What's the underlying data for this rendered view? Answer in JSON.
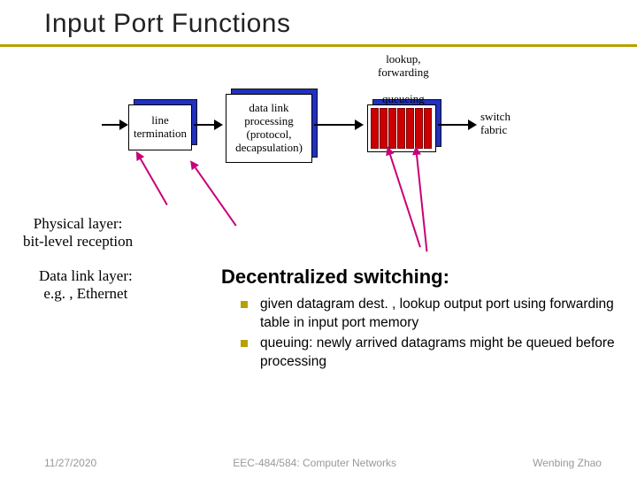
{
  "title": "Input Port Functions",
  "diagram": {
    "box1": "line\ntermination",
    "box2": "data link\nprocessing\n(protocol,\ndecapsulation)",
    "box3_label": "lookup,\nforwarding\n\nqueueing",
    "switch_label": "switch\nfabric"
  },
  "annotations": {
    "physical": "Physical layer:\nbit-level reception",
    "datalink": "Data link layer:\ne.g. , Ethernet"
  },
  "decentralized": {
    "heading": "Decentralized switching:",
    "bullets": [
      "given datagram dest. , lookup output port using forwarding table in input port memory",
      "queuing: newly arrived datagrams might be queued before processing"
    ]
  },
  "footer": {
    "date": "11/27/2020",
    "course": "EEC-484/584: Computer Networks",
    "author": "Wenbing Zhao"
  }
}
